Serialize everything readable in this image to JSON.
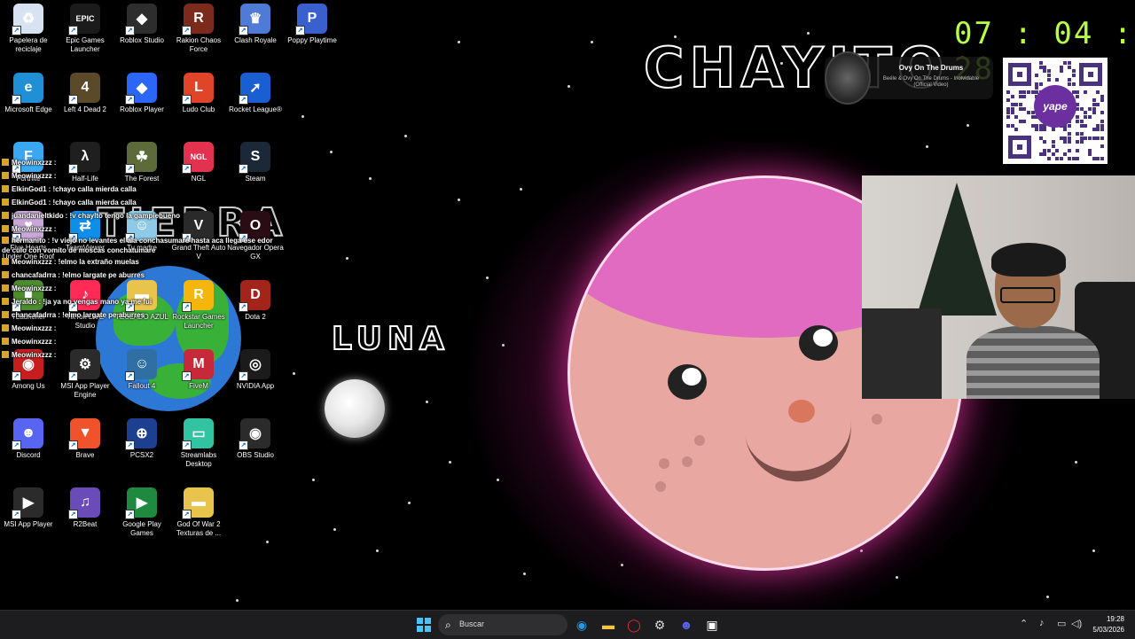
{
  "desktop_icons": [
    {
      "label": "Papelera de reciclaje",
      "icon": "recycle-bin-icon",
      "color": "#d7e3f2",
      "glyph": "♻"
    },
    {
      "label": "Epic Games Launcher",
      "icon": "epic-games-icon",
      "color": "#1b1b1b",
      "glyph": "EPIC"
    },
    {
      "label": "Roblox Studio",
      "icon": "roblox-studio-icon",
      "color": "#2d2d2d",
      "glyph": "◆"
    },
    {
      "label": "Rakion Chaos Force",
      "icon": "rakion-icon",
      "color": "#7b2a1c",
      "glyph": "R"
    },
    {
      "label": "Clash Royale",
      "icon": "clash-royale-icon",
      "color": "#4f7ad6",
      "glyph": "♛"
    },
    {
      "label": "Poppy Playtime",
      "icon": "poppy-playtime-icon",
      "color": "#3a5fcf",
      "glyph": "P"
    },
    {
      "label": "Microsoft Edge",
      "icon": "edge-icon",
      "color": "#1f8fd6",
      "glyph": "e"
    },
    {
      "label": "Left 4 Dead 2",
      "icon": "left4dead-icon",
      "color": "#5a4a2a",
      "glyph": "4"
    },
    {
      "label": "Roblox Player",
      "icon": "roblox-player-icon",
      "color": "#2b67f6",
      "glyph": "◆"
    },
    {
      "label": "Ludo Club",
      "icon": "ludo-club-icon",
      "color": "#e0452a",
      "glyph": "L"
    },
    {
      "label": "Rocket League®",
      "icon": "rocket-league-icon",
      "color": "#1a5fd1",
      "glyph": "➚"
    },
    {
      "label": "Fortnite",
      "icon": "fortnite-icon",
      "color": "#3aa8f0",
      "glyph": "F"
    },
    {
      "label": "Half-Life",
      "icon": "half-life-icon",
      "color": "#1f1f1f",
      "glyph": "λ"
    },
    {
      "label": "The Forest",
      "icon": "the-forest-icon",
      "color": "#5d6b3a",
      "glyph": "☘"
    },
    {
      "label": "NGL",
      "icon": "ngl-icon",
      "color": "#e2324f",
      "glyph": "NGL"
    },
    {
      "label": "Steam",
      "icon": "steam-icon",
      "color": "#1b2838",
      "glyph": "S"
    },
    {
      "label": "Five Hearts Under One Roof",
      "icon": "five-hearts-icon",
      "color": "#c7a8d8",
      "glyph": "♥"
    },
    {
      "label": "TeamViewer",
      "icon": "teamviewer-icon",
      "color": "#0e8ee9",
      "glyph": "⇄"
    },
    {
      "label": "Tu madre",
      "icon": "tu-madre-icon",
      "color": "#8ecae6",
      "glyph": "☺"
    },
    {
      "label": "Grand Theft Auto V",
      "icon": "gta-v-icon",
      "color": "#2a2a2a",
      "glyph": "V"
    },
    {
      "label": "Navegador Opera GX",
      "icon": "opera-gx-icon",
      "color": "#2a0d14",
      "glyph": "O"
    },
    {
      "label": "TLauncher",
      "icon": "tlauncher-icon",
      "color": "#4c8c2f",
      "glyph": "■"
    },
    {
      "label": "TikTok LIVE Studio",
      "icon": "tiktok-live-icon",
      "color": "#ff2a55",
      "glyph": "♪"
    },
    {
      "label": "TECLADO AZUL",
      "icon": "folder-icon",
      "color": "#e8c44c",
      "glyph": "▬"
    },
    {
      "label": "Rockstar Games Launcher",
      "icon": "rockstar-icon",
      "color": "#f5b60b",
      "glyph": "R"
    },
    {
      "label": "Dota 2",
      "icon": "dota2-icon",
      "color": "#a3241a",
      "glyph": "D"
    },
    {
      "label": "Among Us",
      "icon": "among-us-icon",
      "color": "#c61e1e",
      "glyph": "◉"
    },
    {
      "label": "MSI App Player Engine",
      "icon": "msi-engine-icon",
      "color": "#2b2b2b",
      "glyph": "⚙"
    },
    {
      "label": "Fallout 4",
      "icon": "fallout4-icon",
      "color": "#2f6fa3",
      "glyph": "☺"
    },
    {
      "label": "FiveM",
      "icon": "fivem-icon",
      "color": "#c62a3a",
      "glyph": "M"
    },
    {
      "label": "NVIDIA App",
      "icon": "nvidia-icon",
      "color": "#1b1b1b",
      "glyph": "◎"
    },
    {
      "label": "Discord",
      "icon": "discord-icon",
      "color": "#5865f2",
      "glyph": "☻"
    },
    {
      "label": "Brave",
      "icon": "brave-icon",
      "color": "#f0532b",
      "glyph": "▼"
    },
    {
      "label": "PCSX2",
      "icon": "pcsx2-icon",
      "color": "#1d3f8f",
      "glyph": "⊕"
    },
    {
      "label": "Streamlabs Desktop",
      "icon": "streamlabs-icon",
      "color": "#31c3a2",
      "glyph": "▭"
    },
    {
      "label": "OBS Studio",
      "icon": "obs-icon",
      "color": "#2b2b2b",
      "glyph": "◉"
    },
    {
      "label": "MSI App Player",
      "icon": "msi-player-icon",
      "color": "#2b2b2b",
      "glyph": "▶"
    },
    {
      "label": "R2Beat",
      "icon": "r2beat-icon",
      "color": "#6b4bb8",
      "glyph": "♫"
    },
    {
      "label": "Google Play Games",
      "icon": "google-play-games-icon",
      "color": "#1f8a3f",
      "glyph": "▶"
    },
    {
      "label": "God Of War 2 Texturas de ...",
      "icon": "folder-icon",
      "color": "#e8c44c",
      "glyph": "▬"
    }
  ],
  "drawings": {
    "chayito": "CHAYITO",
    "tierra": "TIERRA",
    "luna": "LUNA"
  },
  "chat": [
    {
      "user": "Meowinxzzz",
      "text": ":"
    },
    {
      "user": "Meowinxzzz",
      "text": ":"
    },
    {
      "user": "ElkinGod1",
      "text": ": !chayo calla mierda calla"
    },
    {
      "user": "ElkinGod1",
      "text": ": !chayo calla mierda calla"
    },
    {
      "user": "juandanieltkido",
      "text": ": !v chaylto tengo la gampiebueno"
    },
    {
      "user": "Meowinxzzz",
      "text": ":"
    },
    {
      "user": "hermanito",
      "text": ": !v viejo no levantes el ala conchasumare hasta aca llega ese edor de culo con vomito de moscas conchatumare"
    },
    {
      "user": "Meowinxzzz",
      "text": ": !elmo la extraño muelas"
    },
    {
      "user": "chancafadrra",
      "text": ": !elmo largate pe aburres"
    },
    {
      "user": "Meowinxzzz",
      "text": ":"
    },
    {
      "user": "Jeraldo",
      "text": ": !ja ya no vengas mano ya me fui"
    },
    {
      "user": "chancafadrra",
      "text": ": !elmo largate pe aburres"
    },
    {
      "user": "Meowinxzzz",
      "text": ":"
    },
    {
      "user": "Meowinxzzz",
      "text": ":"
    },
    {
      "user": "Meowinxzzz",
      "text": ":"
    }
  ],
  "stream_clock": {
    "h": "07",
    "m": "04",
    "s": "28",
    "sep": ":"
  },
  "now_playing": {
    "title": "Ovy On The Drums",
    "artist": "Beéle & Ovy On The Drums - Inolvidable (Official Video)"
  },
  "qr": {
    "brand": "yape"
  },
  "taskbar": {
    "search_placeholder": "Buscar",
    "time": "19:28",
    "date": "5/03/2026"
  },
  "colors": {
    "clock": "#b7ff47",
    "planet_cap": "#e06bc0",
    "planet_body": "#e8a7a0",
    "taskbar": "#1d1d1f"
  }
}
